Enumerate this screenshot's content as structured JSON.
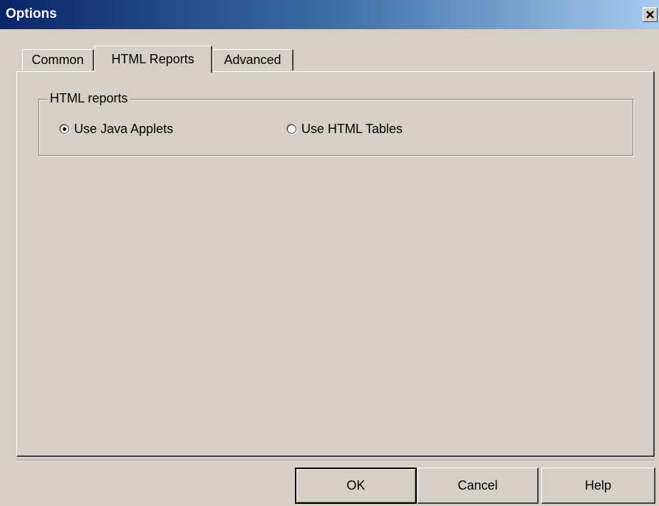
{
  "window": {
    "title": "Options"
  },
  "tabs": [
    {
      "label": "Common",
      "active": false
    },
    {
      "label": "HTML Reports",
      "active": true
    },
    {
      "label": "Advanced",
      "active": false
    }
  ],
  "html_reports_group": {
    "legend": "HTML reports",
    "options": [
      {
        "label": "Use Java Applets",
        "checked": true
      },
      {
        "label": "Use HTML Tables",
        "checked": false
      }
    ]
  },
  "buttons": {
    "ok": "OK",
    "cancel": "Cancel",
    "help": "Help"
  },
  "icons": {
    "close": "close-icon"
  },
  "colors": {
    "titlebar_start": "#0a246a",
    "titlebar_end": "#a6caf0",
    "face": "#d4d0c8"
  }
}
